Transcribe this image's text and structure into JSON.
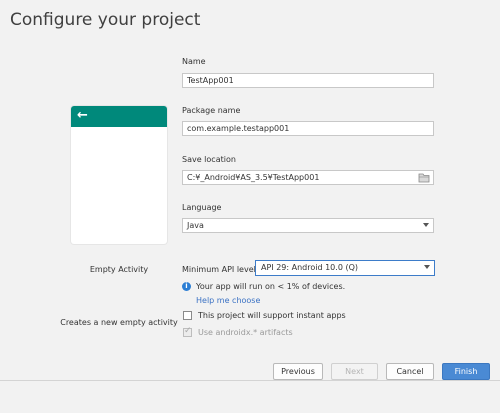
{
  "title": "Configure your project",
  "activity": {
    "name": "Empty Activity",
    "description": "Creates a new empty activity",
    "back_arrow": "arrow-left-icon"
  },
  "form": {
    "name_label": "Name",
    "name_value": "TestApp001",
    "package_label": "Package name",
    "package_value": "com.example.testapp001",
    "location_label": "Save location",
    "location_value": "C:¥_Android¥AS_3.5¥TestApp001",
    "language_label": "Language",
    "language_value": "Java",
    "min_api_label": "Minimum API level",
    "min_api_value": "API 29: Android 10.0 (Q)",
    "info_text": "Your app will run on < 1% of devices.",
    "help_link": "Help me choose",
    "instant_apps_label": "This project will support instant apps",
    "androidx_label": "Use androidx.* artifacts"
  },
  "buttons": {
    "previous": "Previous",
    "next": "Next",
    "cancel": "Cancel",
    "finish": "Finish"
  },
  "colors": {
    "accent_teal": "#00897b",
    "primary_blue": "#4a8ad4",
    "link_blue": "#3b72c4"
  }
}
